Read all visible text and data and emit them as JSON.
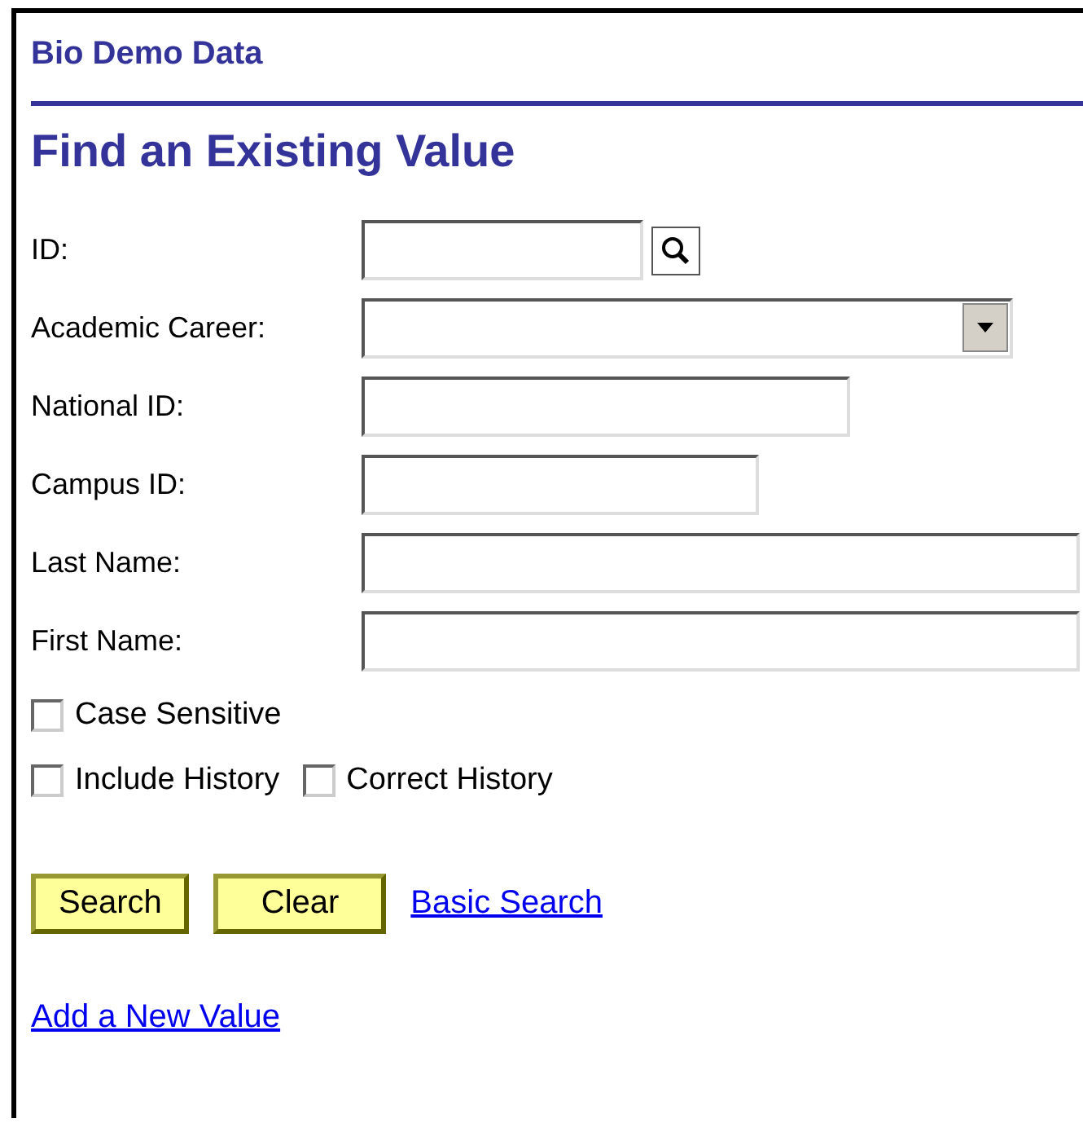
{
  "page_title": "Bio Demo Data",
  "heading": "Find an Existing Value",
  "fields": [
    {
      "label": "ID:",
      "kind": "lookup"
    },
    {
      "label": "Academic Career:",
      "kind": "select"
    },
    {
      "label": "National ID:",
      "kind": "text"
    },
    {
      "label": "Campus ID:",
      "kind": "text"
    },
    {
      "label": "Last Name:",
      "kind": "text"
    },
    {
      "label": "First Name:",
      "kind": "text"
    }
  ],
  "checkbox_rows": [
    [
      {
        "label": "Case Sensitive",
        "checked": false
      }
    ],
    [
      {
        "label": "Include History",
        "checked": false
      },
      {
        "label": "Correct History",
        "checked": false
      }
    ]
  ],
  "buttons": [
    "Search",
    "Clear"
  ],
  "basic_search_link": "Basic Search",
  "add_link": "Add a New Value"
}
